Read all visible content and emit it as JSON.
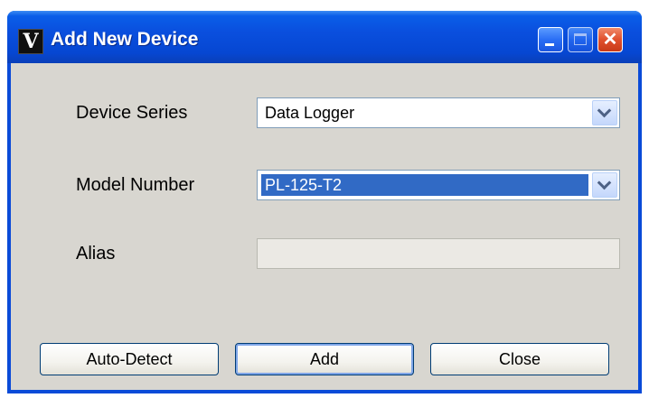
{
  "window": {
    "title": "Add New Device",
    "icon_glyph": "V",
    "close_glyph": "✕"
  },
  "form": {
    "device_series": {
      "label": "Device Series",
      "value": "Data Logger"
    },
    "model_number": {
      "label": "Model Number",
      "value": "PL-125-T2"
    },
    "alias": {
      "label": "Alias",
      "value": ""
    }
  },
  "buttons": {
    "auto_detect": "Auto-Detect",
    "add": "Add",
    "close": "Close"
  },
  "colors": {
    "titlebar": "#0a4fde",
    "selection": "#316ac5",
    "client_bg": "#d8d6d0"
  }
}
